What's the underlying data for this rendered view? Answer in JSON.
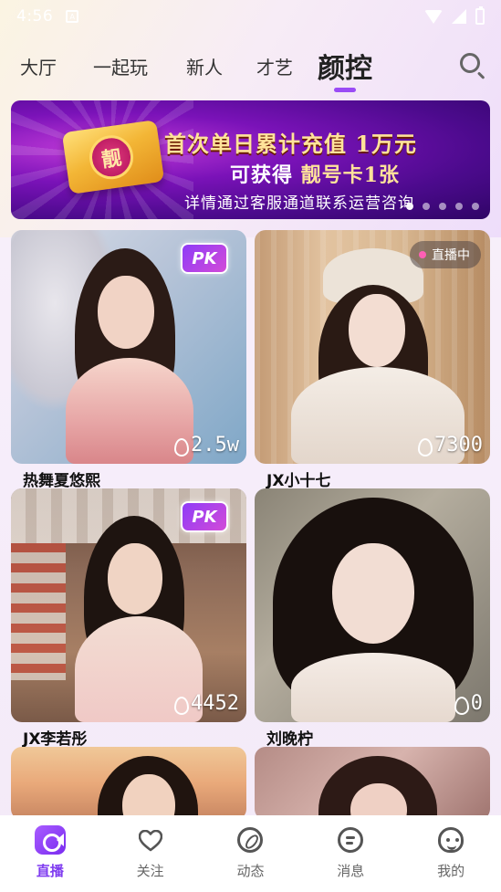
{
  "status_bar": {
    "time": "4:56",
    "notification_glyph": "A"
  },
  "tabs": [
    {
      "label": "大厅",
      "active": false
    },
    {
      "label": "一起玩",
      "active": false
    },
    {
      "label": "新人",
      "active": false
    },
    {
      "label": "才艺",
      "active": false
    },
    {
      "label": "颜控",
      "active": true
    }
  ],
  "search": {
    "icon": "search-icon"
  },
  "banner": {
    "card_glyph": "靓",
    "line1": "首次单日累计充值 1万元",
    "line2_prefix": "可获得 ",
    "line2_highlight": "靓号卡1张",
    "line3": "详情通过客服通道联系运营咨询",
    "page_count": 5,
    "active_page": 1
  },
  "cards": [
    {
      "name": "热舞夏悠熙",
      "viewers": "2.5w",
      "pk": true,
      "live": false,
      "pk_label": "PK"
    },
    {
      "name": "JX小十七",
      "viewers": "7300",
      "pk": false,
      "live": true,
      "live_label": "直播中"
    },
    {
      "name": "JX李若彤",
      "viewers": "4452",
      "pk": true,
      "live": false,
      "pk_label": "PK"
    },
    {
      "name": "刘晚柠",
      "viewers": "0",
      "pk": false,
      "live": false
    },
    {
      "name": "",
      "viewers": "",
      "pk": false,
      "live": false
    },
    {
      "name": "",
      "viewers": "",
      "pk": false,
      "live": false
    }
  ],
  "bottom_nav": [
    {
      "label": "直播",
      "icon": "live-video-icon",
      "active": true
    },
    {
      "label": "关注",
      "icon": "heart-icon",
      "active": false
    },
    {
      "label": "动态",
      "icon": "compass-icon",
      "active": false
    },
    {
      "label": "消息",
      "icon": "message-icon",
      "active": false
    },
    {
      "label": "我的",
      "icon": "profile-face-icon",
      "active": false
    }
  ],
  "colors": {
    "accent": "#7f3cf0",
    "indicator": "#9a4bf5",
    "live_dot": "#ff5fb5",
    "banner_gold": "#ffe39a"
  }
}
